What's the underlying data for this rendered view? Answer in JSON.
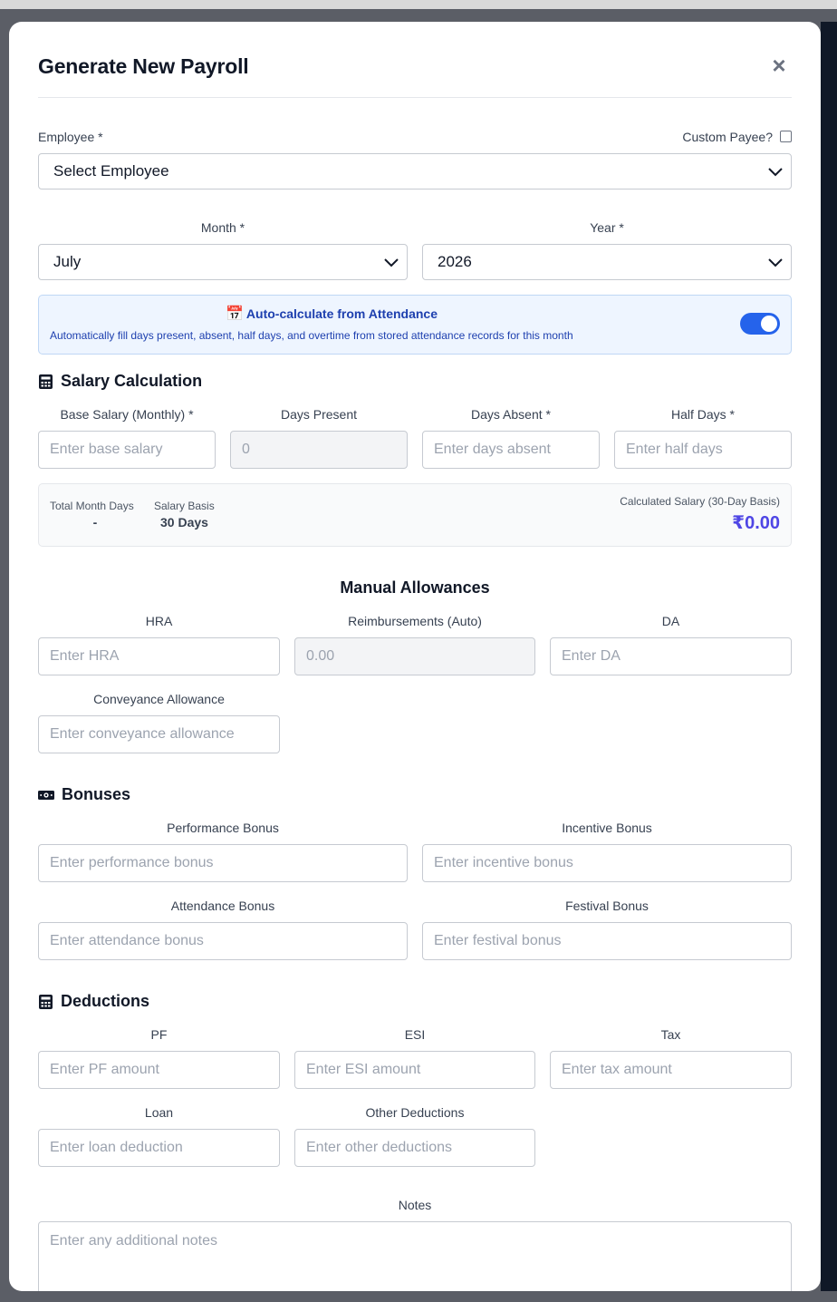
{
  "modal": {
    "title": "Generate New Payroll",
    "close_icon": "×"
  },
  "employee": {
    "label": "Employee *",
    "custom_payee_label": "Custom Payee?",
    "custom_payee_checked": false,
    "selected": "Select Employee"
  },
  "month": {
    "label": "Month *",
    "selected": "July"
  },
  "year": {
    "label": "Year *",
    "selected": "2026"
  },
  "autocalc": {
    "icon": "📅",
    "title": "Auto-calculate from Attendance",
    "description": "Automatically fill days present, absent, half days, and overtime from stored attendance records for this month",
    "enabled": true
  },
  "salary": {
    "title": "Salary Calculation",
    "base_salary_label": "Base Salary (Monthly) *",
    "base_salary_placeholder": "Enter base salary",
    "days_present_label": "Days Present",
    "days_present_value": "0",
    "days_absent_label": "Days Absent *",
    "days_absent_placeholder": "Enter days absent",
    "half_days_label": "Half Days *",
    "half_days_placeholder": "Enter half days",
    "total_month_days_label": "Total Month Days",
    "total_month_days_value": "-",
    "salary_basis_label": "Salary Basis",
    "salary_basis_value": "30 Days",
    "calculated_label": "Calculated Salary (30-Day Basis)",
    "calculated_value": "₹0.00"
  },
  "allowances": {
    "title": "Manual Allowances",
    "hra_label": "HRA",
    "hra_placeholder": "Enter HRA",
    "reimb_label": "Reimbursements (Auto)",
    "reimb_value": "0.00",
    "da_label": "DA",
    "da_placeholder": "Enter DA",
    "conveyance_label": "Conveyance Allowance",
    "conveyance_placeholder": "Enter conveyance allowance"
  },
  "bonuses": {
    "title": "Bonuses",
    "performance_label": "Performance Bonus",
    "performance_placeholder": "Enter performance bonus",
    "incentive_label": "Incentive Bonus",
    "incentive_placeholder": "Enter incentive bonus",
    "attendance_label": "Attendance Bonus",
    "attendance_placeholder": "Enter attendance bonus",
    "festival_label": "Festival Bonus",
    "festival_placeholder": "Enter festival bonus"
  },
  "deductions": {
    "title": "Deductions",
    "pf_label": "PF",
    "pf_placeholder": "Enter PF amount",
    "esi_label": "ESI",
    "esi_placeholder": "Enter ESI amount",
    "tax_label": "Tax",
    "tax_placeholder": "Enter tax amount",
    "loan_label": "Loan",
    "loan_placeholder": "Enter loan deduction",
    "other_label": "Other Deductions",
    "other_placeholder": "Enter other deductions"
  },
  "notes": {
    "label": "Notes",
    "placeholder": "Enter any additional notes"
  },
  "colors": {
    "accent": "#2563eb",
    "calculated_value": "#4f46e5",
    "info_title": "#1e40af"
  }
}
